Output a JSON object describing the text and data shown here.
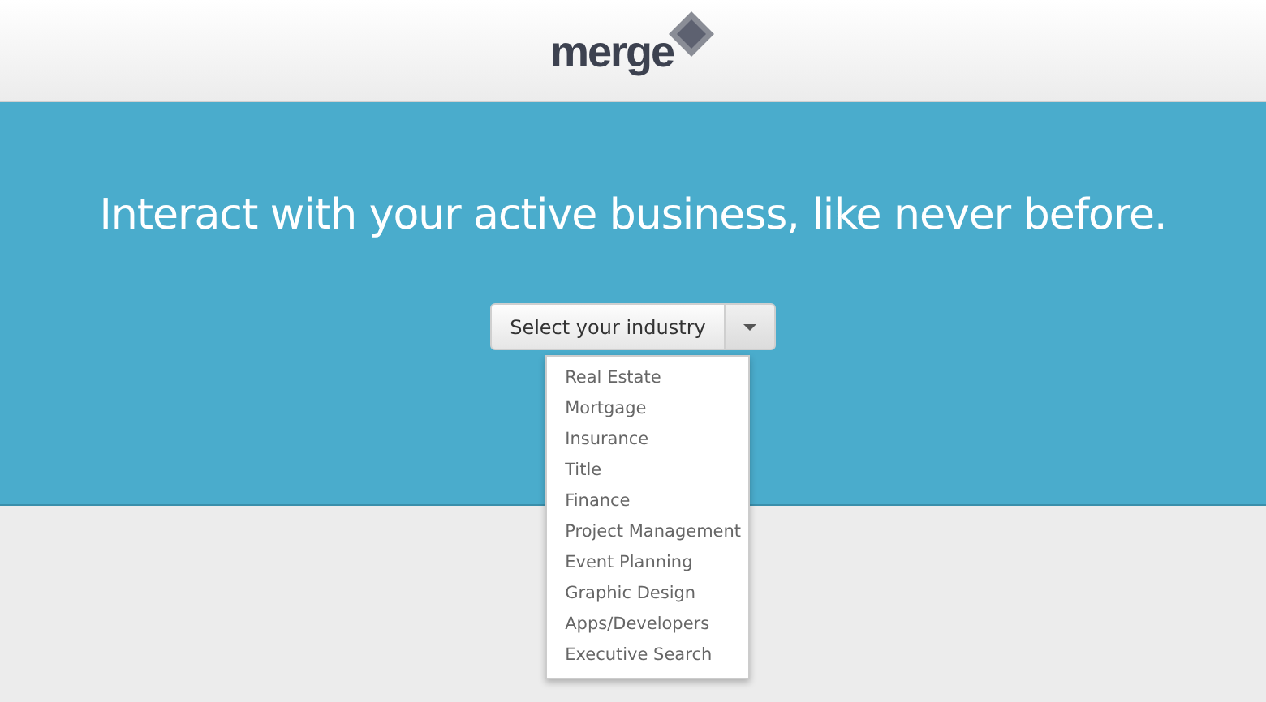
{
  "logo": {
    "text": "merge"
  },
  "hero": {
    "headline": "Interact with your active business, like never before."
  },
  "industry_select": {
    "label": "Select your industry",
    "expanded": true,
    "options": [
      "Real Estate",
      "Mortgage",
      "Insurance",
      "Title",
      "Finance",
      "Project Management",
      "Event Planning",
      "Graphic Design",
      "Apps/Developers",
      "Executive Search"
    ]
  }
}
